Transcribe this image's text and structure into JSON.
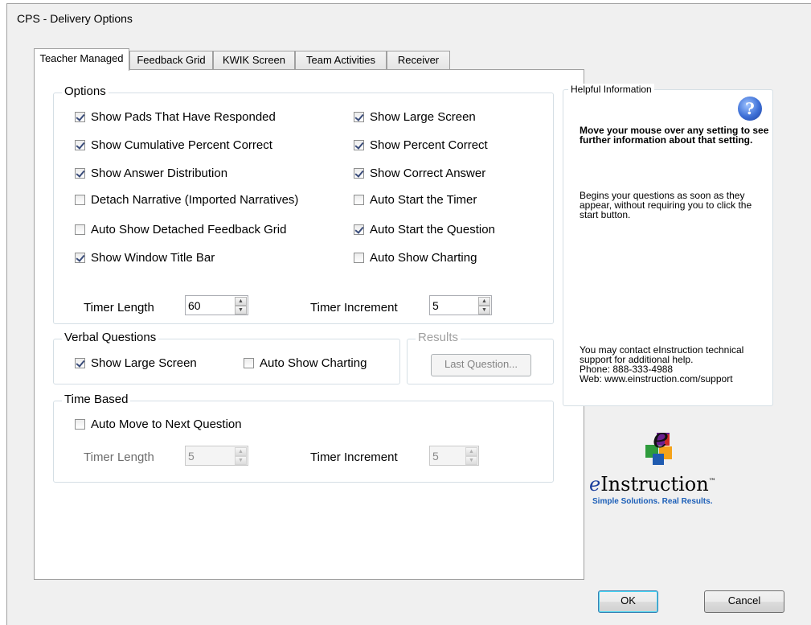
{
  "window": {
    "title": "CPS - Delivery Options"
  },
  "tabs": [
    "Teacher Managed",
    "Feedback Grid",
    "KWIK Screen",
    "Team Activities",
    "Receiver"
  ],
  "options": {
    "title": "Options",
    "checkboxes": [
      {
        "label": "Show Pads That Have Responded",
        "checked": true
      },
      {
        "label": "Show Cumulative Percent Correct",
        "checked": true
      },
      {
        "label": "Show Answer Distribution",
        "checked": true
      },
      {
        "label": "Detach Narrative (Imported Narratives)",
        "checked": false
      },
      {
        "label": "Auto Show Detached Feedback Grid",
        "checked": false
      },
      {
        "label": "Show Window Title Bar",
        "checked": true
      },
      {
        "label": "Show Large Screen",
        "checked": true
      },
      {
        "label": "Show Percent Correct",
        "checked": true
      },
      {
        "label": "Show Correct Answer",
        "checked": true
      },
      {
        "label": "Auto Start the Timer",
        "checked": false
      },
      {
        "label": "Auto Start the Question",
        "checked": true
      },
      {
        "label": "Auto Show Charting",
        "checked": false
      }
    ],
    "timer_length_label": "Timer Length",
    "timer_length_value": "60",
    "timer_increment_label": "Timer Increment",
    "timer_increment_value": "5"
  },
  "verbal": {
    "title": "Verbal Questions",
    "show_large_screen": "Show Large Screen",
    "auto_show_charting": "Auto Show Charting"
  },
  "results": {
    "title": "Results",
    "button": "Last Question..."
  },
  "time_based": {
    "title": "Time Based",
    "auto_move": "Auto Move to Next Question",
    "timer_length_label": "Timer Length",
    "timer_length_value": "5",
    "timer_increment_label": "Timer Increment",
    "timer_increment_value": "5"
  },
  "help": {
    "title": "Helpful Information",
    "bold_text": "Move your mouse over any setting to see further information about that setting.",
    "description": "Begins your questions as soon as they appear, without requiring you to click the start button.",
    "contact_line1": "You may contact eInstruction technical support for additional help.",
    "contact_phone": "Phone: 888-333-4988",
    "contact_web": "Web: www.einstruction.com/support"
  },
  "logo": {
    "e": "e",
    "name": "Instruction",
    "tm": "™",
    "tagline": "Simple Solutions. Real Results."
  },
  "buttons": {
    "ok": "OK",
    "cancel": "Cancel"
  }
}
